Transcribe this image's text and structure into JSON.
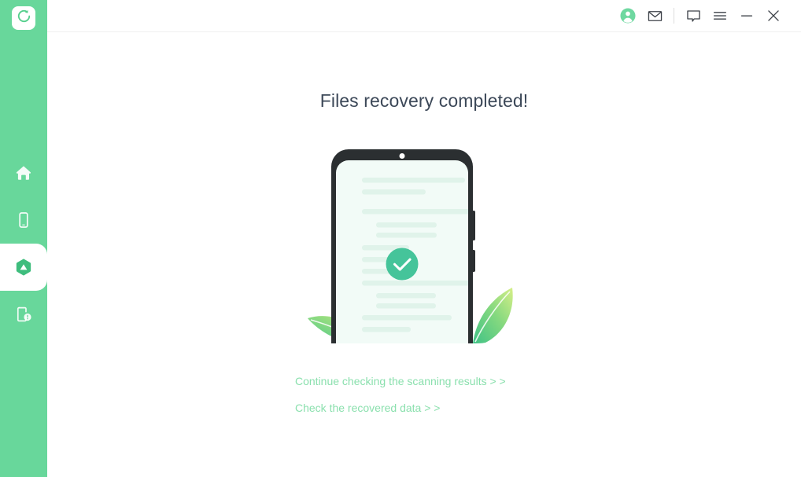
{
  "app": {
    "logo_icon": "recovery-refresh-icon",
    "accent_green": "#68d79b",
    "title_color": "#3c4858",
    "link_color": "#8be0ae",
    "check_circle_color": "#45c49a",
    "phone_frame_color": "#2b2f31",
    "phone_screen_color": "#f2fbf7"
  },
  "sidebar": {
    "items": [
      {
        "name": "sidebar-item-home",
        "icon": "home-icon",
        "active": false
      },
      {
        "name": "sidebar-item-device",
        "icon": "mobile-phone-icon",
        "active": false
      },
      {
        "name": "sidebar-item-recover",
        "icon": "cloud-recovery-icon",
        "active": true
      },
      {
        "name": "sidebar-item-repair",
        "icon": "device-repair-icon",
        "active": false
      }
    ]
  },
  "titlebar": {
    "buttons": [
      {
        "name": "account-avatar-button",
        "icon": "user-avatar-icon"
      },
      {
        "name": "mail-button",
        "icon": "envelope-icon"
      },
      {
        "name": "divider",
        "icon": "divider"
      },
      {
        "name": "feedback-button",
        "icon": "speech-bubble-icon"
      },
      {
        "name": "menu-button",
        "icon": "hamburger-menu-icon"
      },
      {
        "name": "minimize-button",
        "icon": "minimize-icon"
      },
      {
        "name": "close-button",
        "icon": "close-x-icon"
      }
    ]
  },
  "main": {
    "title": "Files recovery completed!",
    "illustration": {
      "name": "phone-recovery-complete-illustration",
      "status_icon": "check-circle-icon"
    },
    "links": [
      {
        "name": "continue-scanning-results-link",
        "label": "Continue checking the scanning results > >"
      },
      {
        "name": "check-recovered-data-link",
        "label": "Check the recovered data > >"
      }
    ]
  }
}
